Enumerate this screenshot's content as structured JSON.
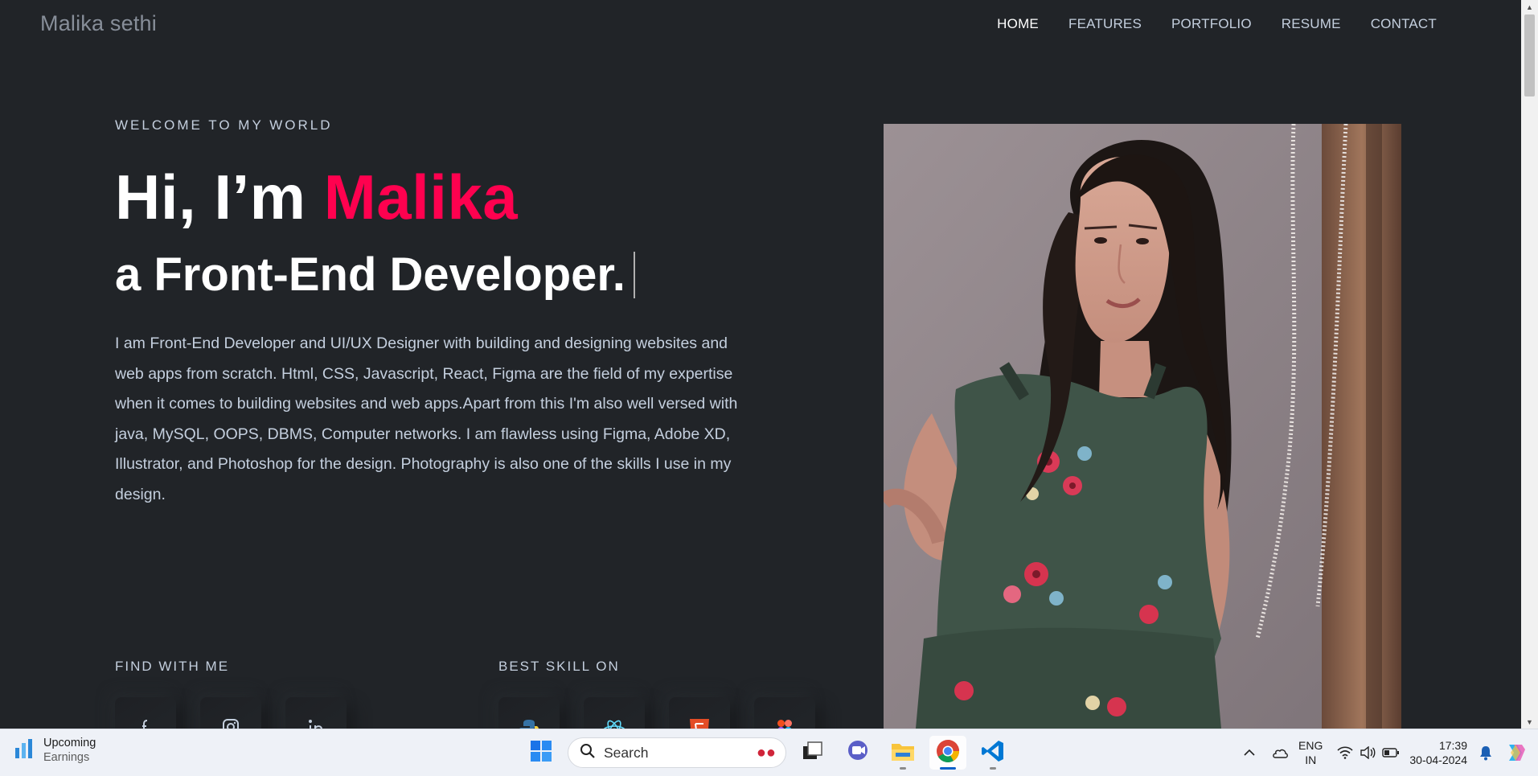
{
  "header": {
    "brand": "Malika sethi",
    "nav": [
      "HOME",
      "FEATURES",
      "PORTFOLIO",
      "RESUME",
      "CONTACT"
    ],
    "active_nav": "HOME"
  },
  "hero": {
    "eyebrow": "WELCOME TO MY WORLD",
    "title_prefix": "Hi, I’m ",
    "title_name": "Malika",
    "subtitle": "a Front-End Developer.",
    "description": "I am Front-End Developer and UI/UX Designer with building and designing websites and web apps from scratch. Html, CSS, Javascript, React, Figma are the field of my expertise when it comes to building websites and web apps.Apart from this I'm also well versed with java, MySQL, OOPS, DBMS, Computer networks. I am flawless using Figma, Adobe XD, Illustrator, and Photoshop for the design. Photography is also one of the skills I use in my design.",
    "find_label": "FIND WITH ME",
    "skill_label": "BEST SKILL ON",
    "social_icons": [
      "facebook-icon",
      "instagram-icon",
      "linkedin-icon"
    ],
    "skill_icons": [
      "python-icon",
      "react-icon",
      "html5-icon",
      "figma-icon"
    ]
  },
  "colors": {
    "background": "#212428",
    "accent": "#ff014f",
    "text": "#c4cfde",
    "heading": "#ffffff"
  },
  "taskbar": {
    "widget_title": "Upcoming",
    "widget_subtitle": "Earnings",
    "search_placeholder": "Search",
    "apps": [
      "start-icon",
      "task-view-icon",
      "teams-chat-icon",
      "file-explorer-icon",
      "chrome-icon",
      "vscode-icon"
    ],
    "active_app": "chrome-icon",
    "lang_line1": "ENG",
    "lang_line2": "IN",
    "time": "17:39",
    "date": "30-04-2024"
  }
}
